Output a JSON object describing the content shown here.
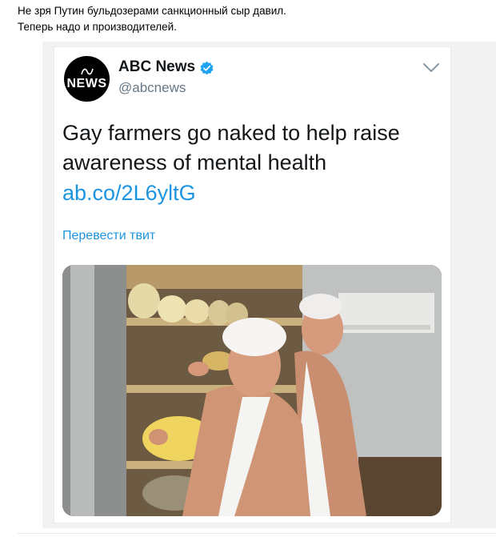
{
  "post": {
    "caption_line1": "Не зря Путин бульдозерами санкционный сыр давил.",
    "caption_line2": "Теперь надо и производителей."
  },
  "tweet": {
    "avatar_text": "NEWS",
    "display_name": "ABC News",
    "handle": "@abcnews",
    "text": "Gay farmers go naked to help raise awareness of mental health",
    "link": "ab.co/2L6yltG",
    "translate_label": "Перевести твит",
    "icons": [
      "abc-logo-icon",
      "verified-badge-icon",
      "chevron-down-icon"
    ],
    "colors": {
      "link": "#1b95e0",
      "verified": "#1da1f2",
      "text": "#14171a",
      "handle": "#657786"
    }
  }
}
